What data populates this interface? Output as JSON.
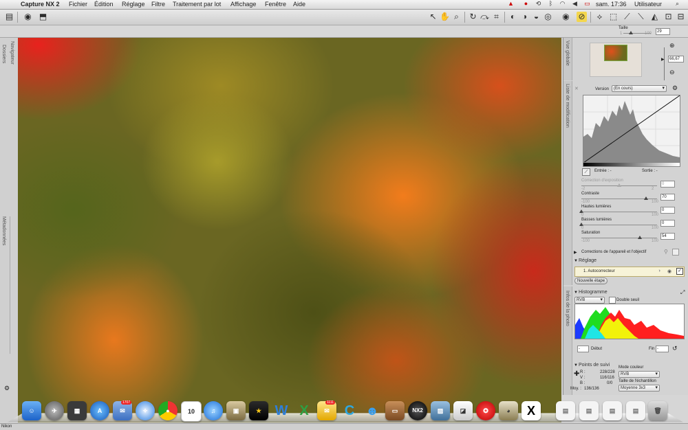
{
  "menubar": {
    "app_name": "Capture NX 2",
    "menus": [
      "Fichier",
      "Édition",
      "Réglage",
      "Filtre",
      "Traitement par lot",
      "Affichage",
      "Fenêtre",
      "Aide"
    ],
    "clock": "sam. 17:36",
    "user": "Utilisateur"
  },
  "toolbar": {
    "size_label": "Taille",
    "size_value": "29",
    "size_min": "1",
    "size_max": "100"
  },
  "left_tabs": {
    "folders": "Dossiers",
    "navigator": "Navigateur",
    "metadata": "Métadonnées"
  },
  "bird_eye": {
    "tab_label": "Vue globale",
    "zoom_value": "66,67"
  },
  "edit_list": {
    "tab_label": "Liste de modification",
    "version_label": "Version",
    "version_value": "(En cours)",
    "entry_label": "Entrée : -",
    "output_label": "Sortie : -",
    "sliders": [
      {
        "label": "Correction d'exposition",
        "min": "-2",
        "max": "2",
        "value": "0",
        "level": 0.5,
        "disabled": true
      },
      {
        "label": "Contraste",
        "min": "-100",
        "max": "100",
        "value": "70",
        "level": 0.85,
        "disabled": false
      },
      {
        "label": "Hautes lumières",
        "min": "0",
        "max": "100",
        "value": "0",
        "level": 0.0,
        "disabled": false
      },
      {
        "label": "Basses lumières",
        "min": "0",
        "max": "100",
        "value": "0",
        "level": 0.0,
        "disabled": false
      },
      {
        "label": "Saturation",
        "min": "-100",
        "max": "100",
        "value": "54",
        "level": 0.77,
        "disabled": false
      }
    ],
    "camera_corrections": "Corrections de l'appareil et l'objectif",
    "adjust_label": "Réglage",
    "step_item": "1. Autocorrecteur",
    "new_step_button": "Nouvelle étape"
  },
  "photo_info": {
    "tab_label": "Infos de la photo",
    "histogram_label": "Histogramme",
    "channel_value": "RVB",
    "double_threshold": "Double seuil",
    "start_value": "-",
    "start_label": "Début",
    "end_label": "Fin",
    "end_value": "-",
    "tracking_label": "Points de suivi",
    "r_label": "R :",
    "r_value": "228/228",
    "v_label": "V :",
    "v_value": "116/116",
    "b_label": "B :",
    "b_value": "0/0",
    "moy_label": "Moy. :",
    "moy_value": "136/136",
    "color_mode_label": "Mode couleur",
    "color_mode_value": "RVB",
    "sample_size_label": "Taille de l'échantillon",
    "sample_size_value": "Moyenne 3x3"
  },
  "dock": {
    "calendar_day": "10",
    "mail_badge": "1707",
    "app_badge": "1111"
  },
  "status": {
    "left_text": "Nikon"
  }
}
